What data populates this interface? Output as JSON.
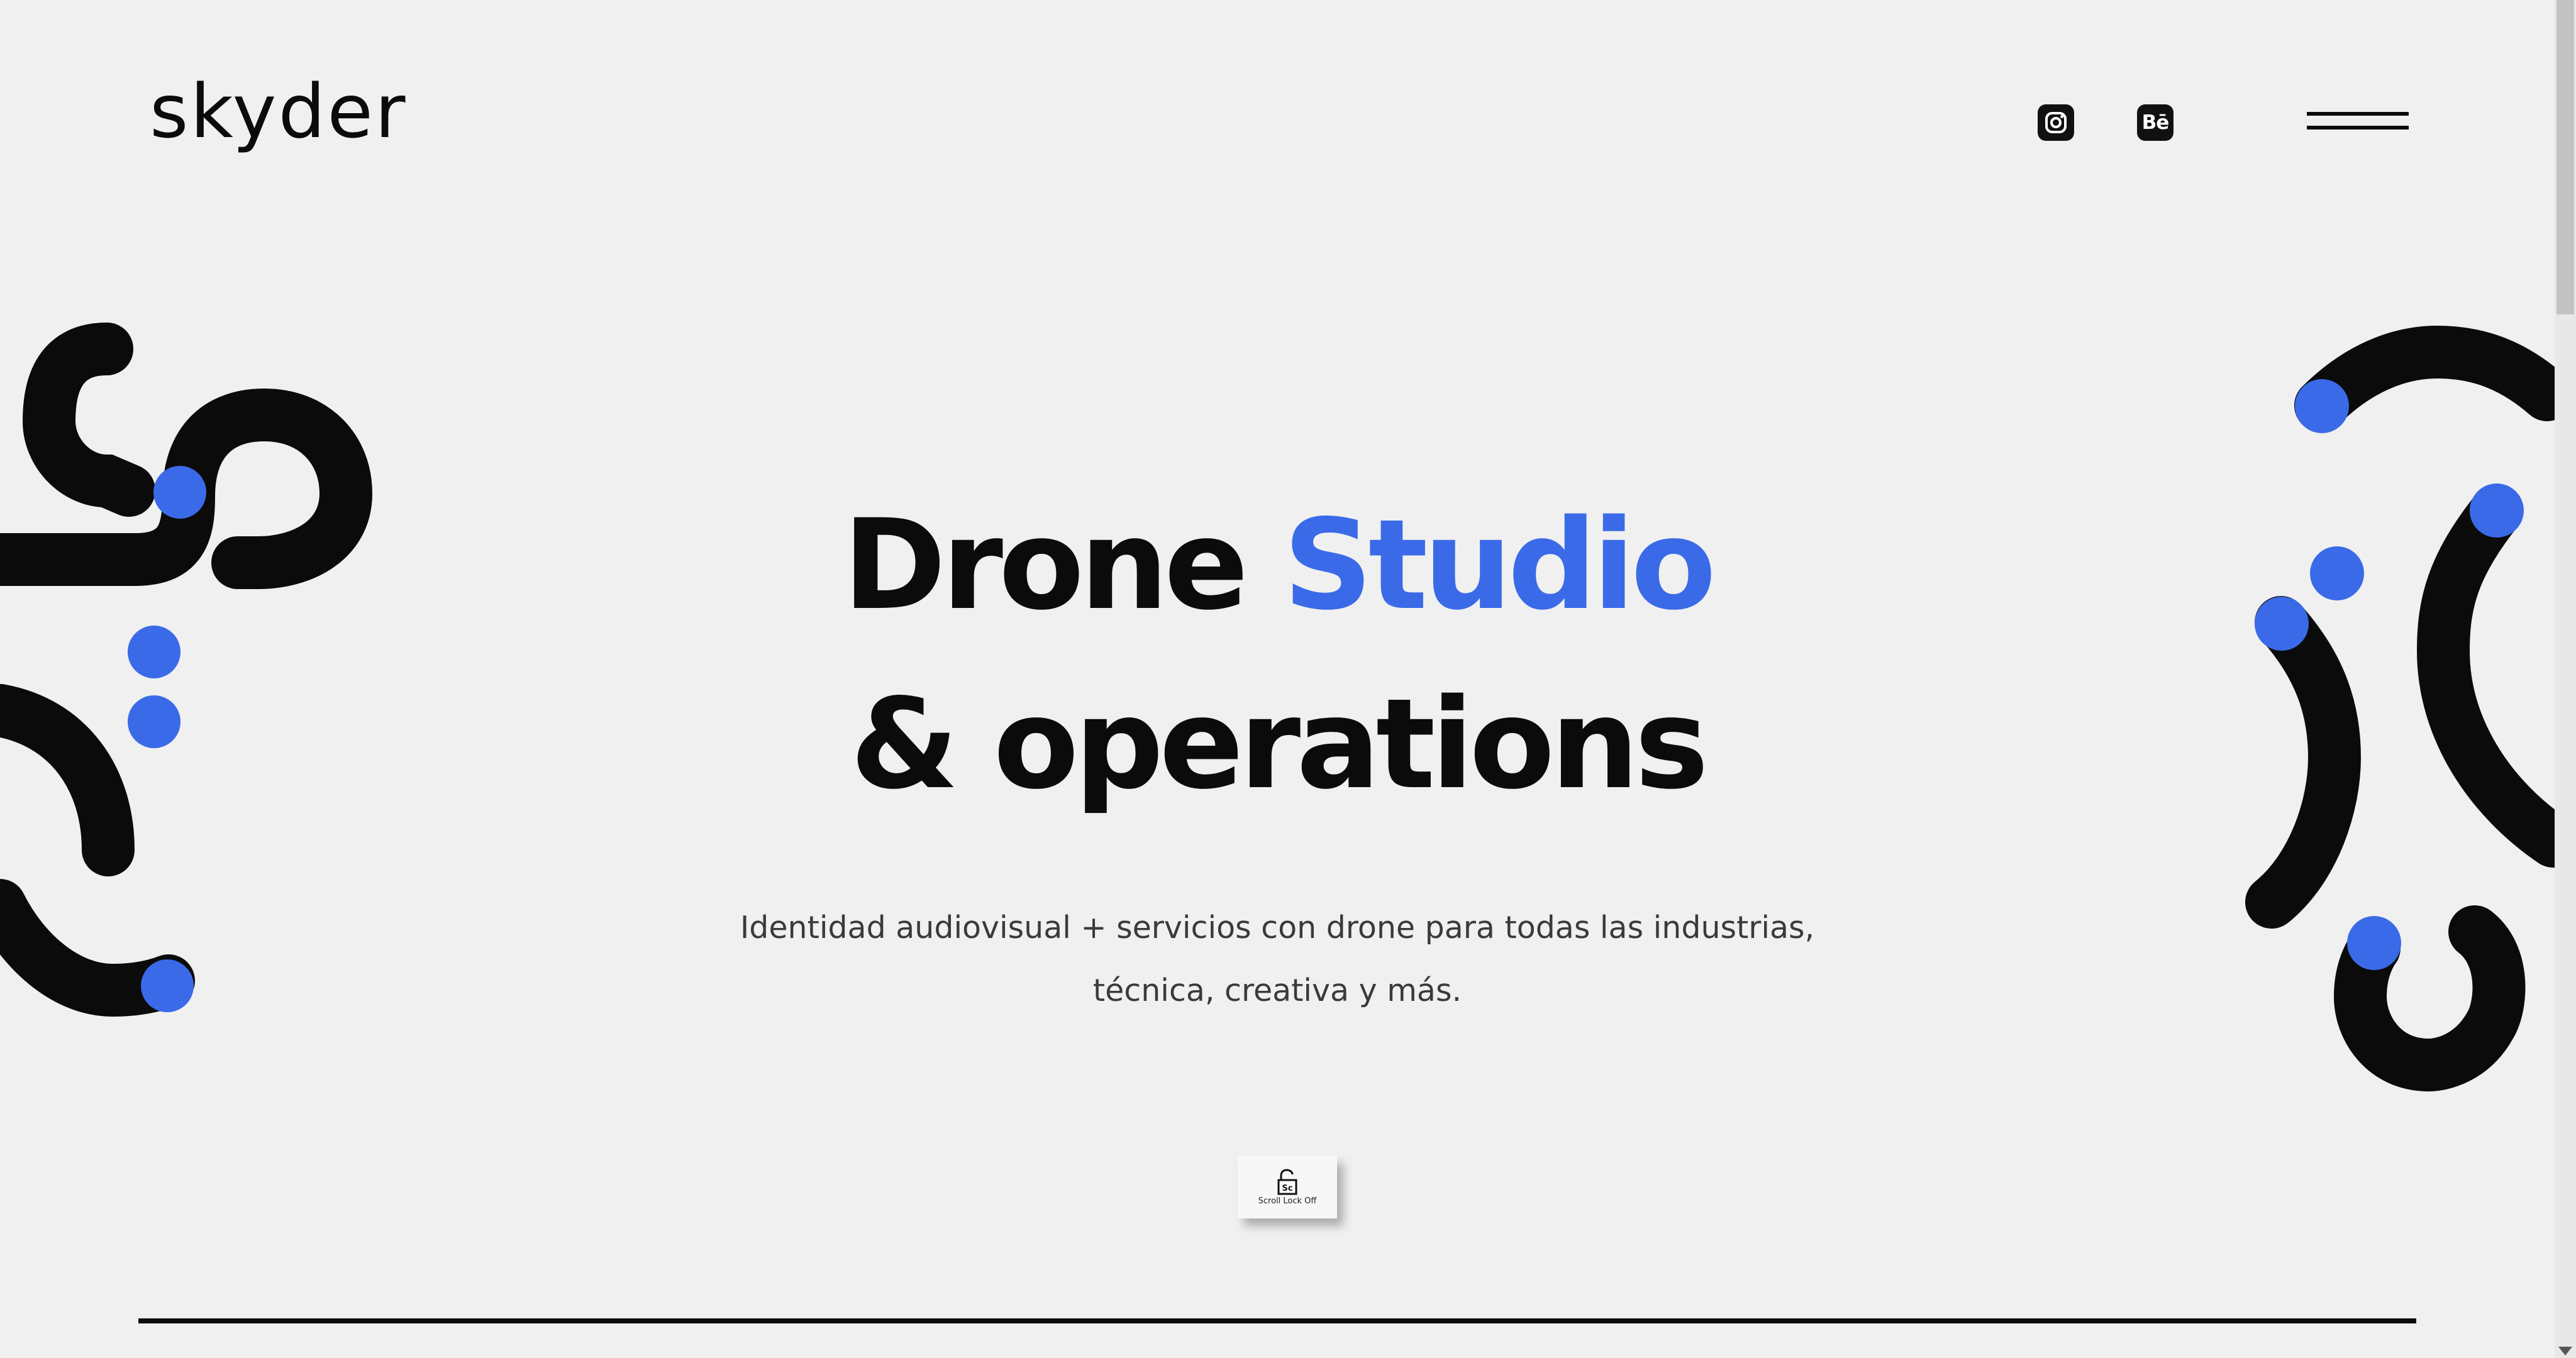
{
  "brand": {
    "logo_text": "skyder"
  },
  "header": {
    "social": [
      {
        "name": "instagram",
        "icon": "instagram-icon"
      },
      {
        "name": "behance",
        "icon": "behance-icon",
        "glyph": "Bē"
      }
    ],
    "menu_icon": "hamburger-icon"
  },
  "hero": {
    "title_part1": "Drone ",
    "title_accent": "Studio",
    "title_line2": "& operations",
    "subtitle_line1": "Identidad audiovisual + servicios con drone para todas las industrias,",
    "subtitle_line2": "técnica, creativa y más."
  },
  "scroll_lock": {
    "icon": "unlocked-padlock-icon",
    "key_label": "Sc",
    "label": "Scroll Lock Off"
  },
  "colors": {
    "accent": "#3a6ae8",
    "ink": "#0b0b0b",
    "background": "#f0f0f0"
  }
}
